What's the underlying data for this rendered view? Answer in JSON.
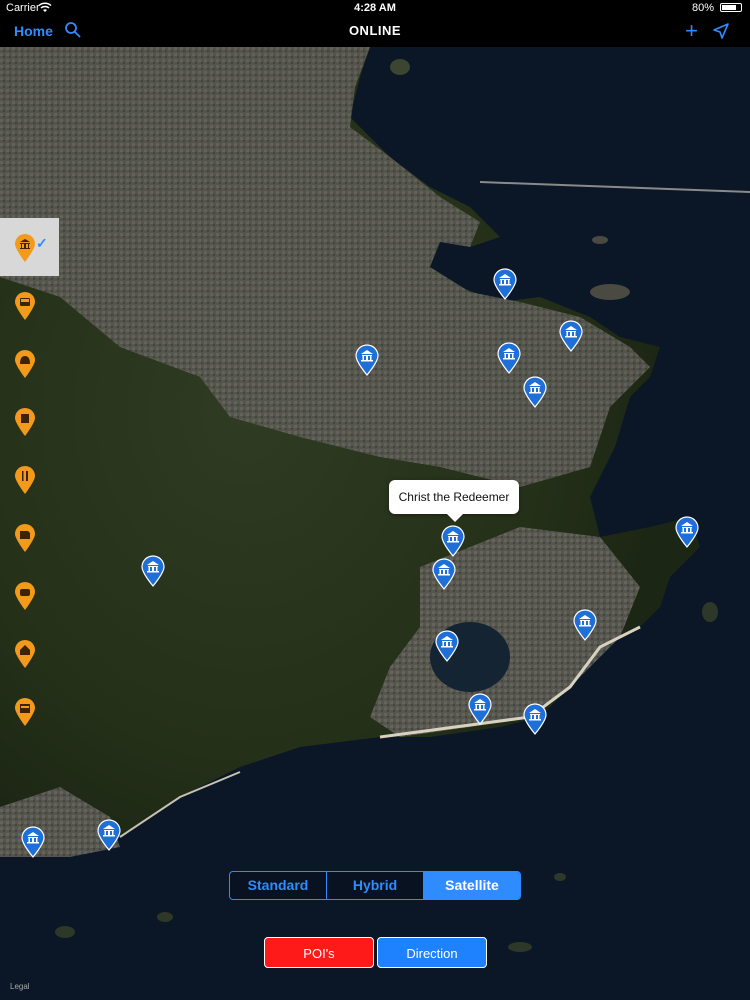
{
  "status_bar": {
    "carrier": "Carrier",
    "time": "4:28 AM",
    "battery": "80%",
    "battery_level": 0.8
  },
  "nav_bar": {
    "home_label": "Home",
    "title": "ONLINE",
    "icons": [
      "search-icon",
      "plus-icon",
      "location-arrow-icon"
    ]
  },
  "map": {
    "callout_text": "Christ the Redeemer",
    "legal": "Legal"
  },
  "poi_categories": [
    {
      "icon": "museum-icon",
      "selected": true
    },
    {
      "icon": "bus-icon",
      "selected": false
    },
    {
      "icon": "bell-icon",
      "selected": false
    },
    {
      "icon": "building-icon",
      "selected": false
    },
    {
      "icon": "restaurant-icon",
      "selected": false
    },
    {
      "icon": "shop-icon",
      "selected": false
    },
    {
      "icon": "car-icon",
      "selected": false
    },
    {
      "icon": "home-icon",
      "selected": false
    },
    {
      "icon": "hotel-icon",
      "selected": false
    }
  ],
  "map_type": {
    "options": [
      "Standard",
      "Hybrid",
      "Satellite"
    ],
    "selected": "Satellite"
  },
  "buttons": {
    "pois_label": "POI's",
    "direction_label": "Direction"
  },
  "colors": {
    "accent": "#2f8cff",
    "poi_button": "#ff1a1a",
    "direction_button": "#1e82ff",
    "category_pin": "#f39a1d",
    "museum_pin": "#1f6fd8"
  }
}
